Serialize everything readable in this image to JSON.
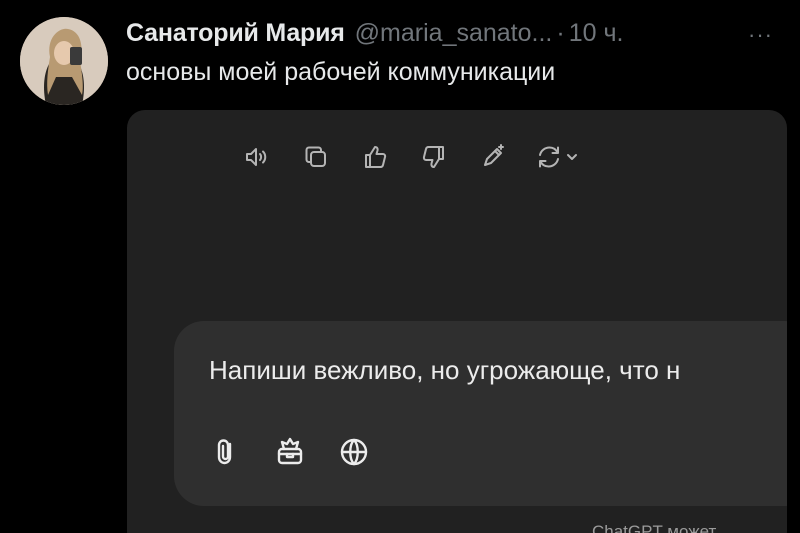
{
  "tweet": {
    "author_name": "Санаторий Мария",
    "handle": "@maria_sanato...",
    "separator": "·",
    "time": "10 ч.",
    "more_label": "···",
    "text": "основы моей рабочей коммуникации"
  },
  "media": {
    "background_color": "#212121",
    "action_bar": {
      "icons": [
        "speaker-icon",
        "copy-icon",
        "thumbs-up-icon",
        "thumbs-down-icon",
        "edit-sparkle-icon",
        "regenerate-icon",
        "chevron-down-icon"
      ]
    },
    "composer": {
      "prompt_text": "Напиши вежливо, но угрожающе, что н",
      "tool_icons": [
        "attach-icon",
        "tools-icon",
        "globe-icon"
      ]
    },
    "footer_note": "ChatGPT может"
  }
}
